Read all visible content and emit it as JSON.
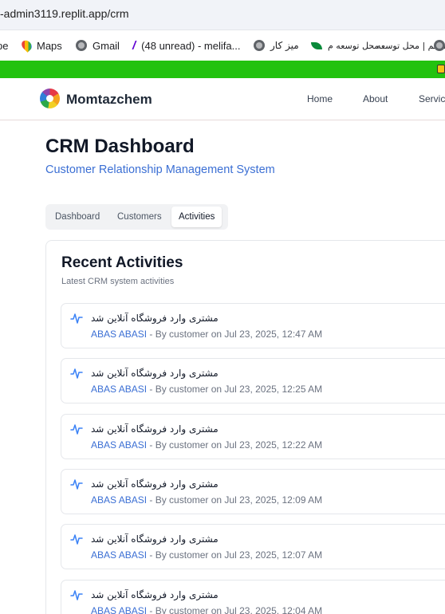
{
  "browser": {
    "url": "-admin3119.replit.app/crm",
    "bookmarks": [
      {
        "label": "pe",
        "icon": "none"
      },
      {
        "label": "Maps",
        "icon": "maps-pin-icon"
      },
      {
        "label": "Gmail",
        "icon": "globe-icon"
      },
      {
        "label": "(48 unread) - melifa...",
        "icon": "yahoo-icon"
      },
      {
        "label": "میز کار",
        "icon": "globe-icon"
      },
      {
        "label": "محل توسعه م...",
        "icon": "leaf-icon"
      },
      {
        "label": "متمم | محل توسعه",
        "icon": "none"
      }
    ]
  },
  "site": {
    "brand": "Momtazchem",
    "nav": [
      "Home",
      "About",
      "Servic"
    ]
  },
  "page": {
    "title": "CRM Dashboard",
    "subtitle": "Customer Relationship Management System"
  },
  "tabs": [
    {
      "label": "Dashboard",
      "active": false
    },
    {
      "label": "Customers",
      "active": false
    },
    {
      "label": "Activities",
      "active": true
    }
  ],
  "activities": {
    "title": "Recent Activities",
    "subtitle": "Latest CRM system activities",
    "items": [
      {
        "description": "مشتری وارد فروشگاه آنلاین شد",
        "customer": "ABAS ABASI",
        "by": "- By customer on Jul 23, 2025, 12:47 AM"
      },
      {
        "description": "مشتری وارد فروشگاه آنلاین شد",
        "customer": "ABAS ABASI",
        "by": "- By customer on Jul 23, 2025, 12:25 AM"
      },
      {
        "description": "مشتری وارد فروشگاه آنلاین شد",
        "customer": "ABAS ABASI",
        "by": "- By customer on Jul 23, 2025, 12:22 AM"
      },
      {
        "description": "مشتری وارد فروشگاه آنلاین شد",
        "customer": "ABAS ABASI",
        "by": "- By customer on Jul 23, 2025, 12:09 AM"
      },
      {
        "description": "مشتری وارد فروشگاه آنلاین شد",
        "customer": "ABAS ABASI",
        "by": "- By customer on Jul 23, 2025, 12:07 AM"
      },
      {
        "description": "مشتری وارد فروشگاه آنلاین شد",
        "customer": "ABAS ABASI",
        "by": "- By customer on Jul 23, 2025, 12:04 AM"
      }
    ]
  },
  "colors": {
    "accent": "#3b6fd4",
    "greenbar": "#22c20f",
    "activity_icon": "#3b82f6"
  }
}
